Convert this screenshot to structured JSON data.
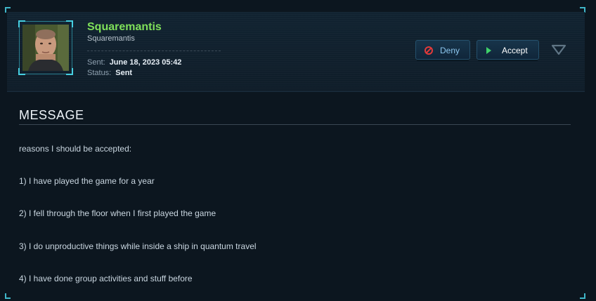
{
  "user": {
    "display_name": "Squaremantis",
    "handle": "Squaremantis",
    "avatar": "user-portrait"
  },
  "meta": {
    "sent_label": "Sent:",
    "sent_value": "June 18, 2023 05:42",
    "status_label": "Status:",
    "status_value": "Sent"
  },
  "actions": {
    "deny_label": "Deny",
    "accept_label": "Accept",
    "more_icon": "chevron-down-icon"
  },
  "message": {
    "title": "MESSAGE",
    "lines": [
      "reasons I should be accepted:",
      "1) I have played the game for a year",
      "2) I fell through the floor when I first played the game",
      "3) I do unproductive things while inside a ship in quantum travel",
      "4) I have done group activities and stuff before"
    ]
  },
  "colors": {
    "name_green": "#7fe05a",
    "deny_red": "#e23a3a",
    "accept_green": "#3fd16a",
    "accent_cyan": "#3fb6c9"
  }
}
